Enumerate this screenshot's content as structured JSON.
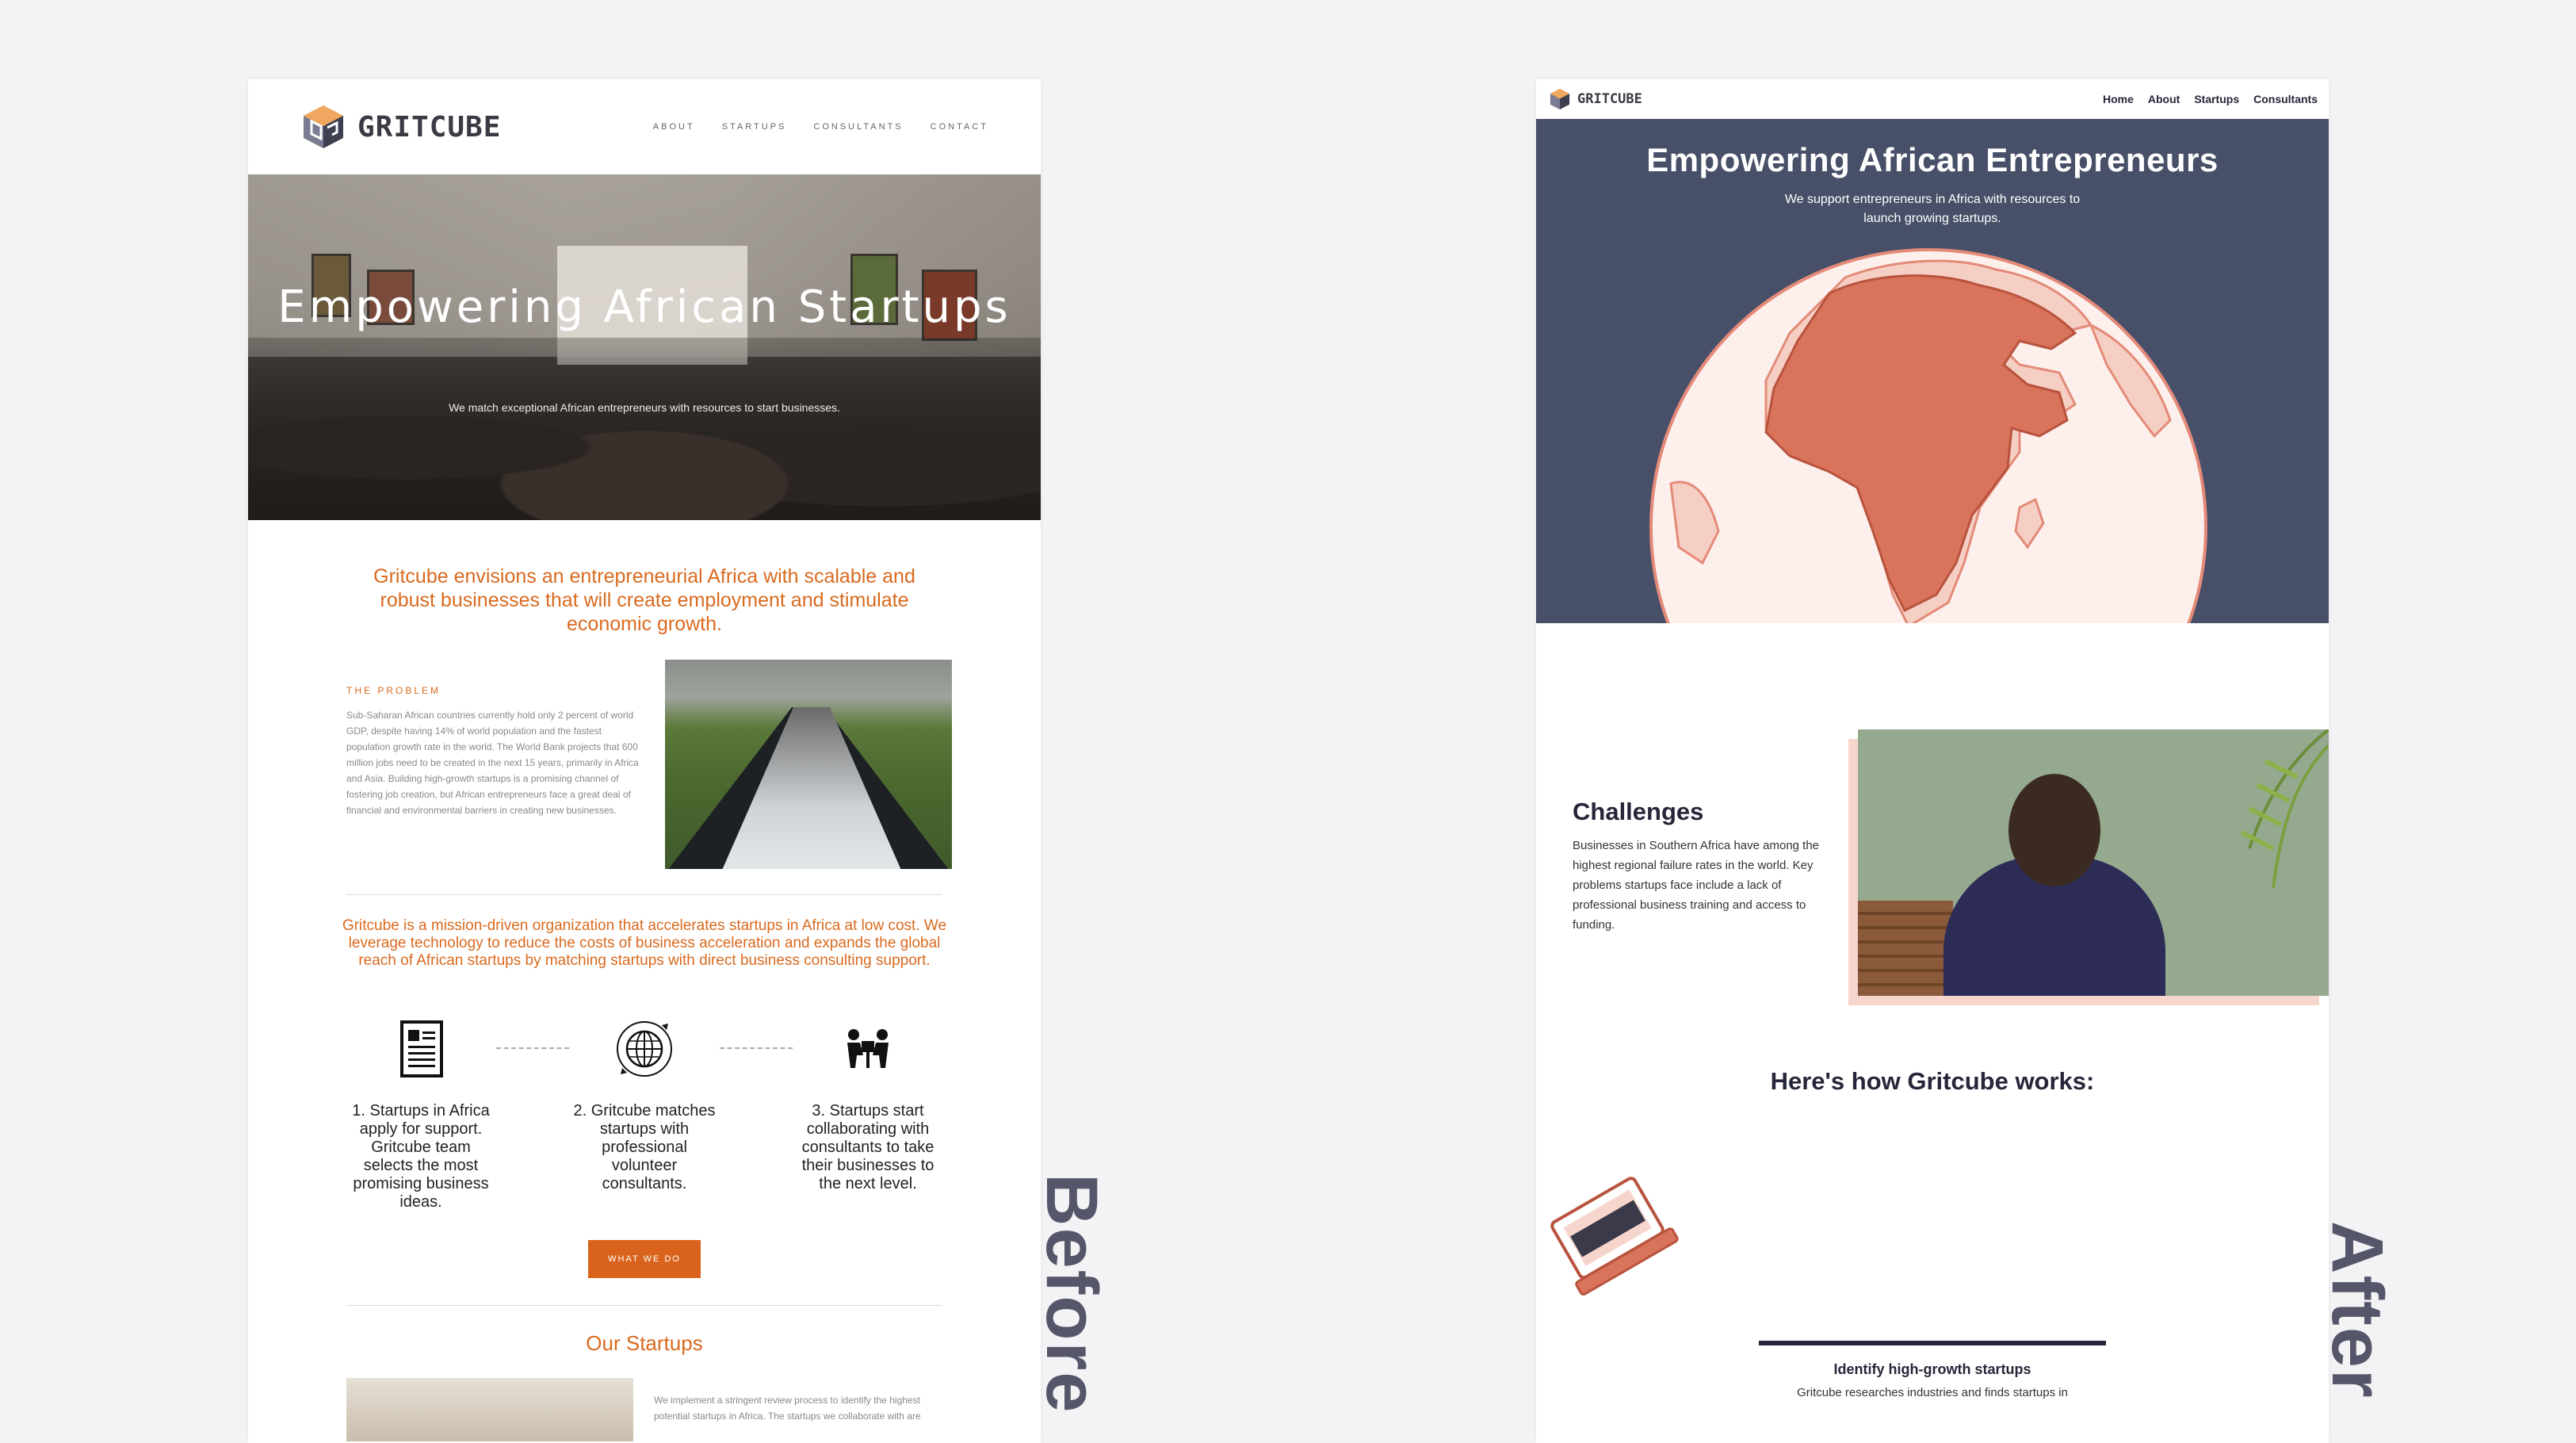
{
  "before": {
    "label": "Before",
    "logo_text": "GRITCUBE",
    "nav": [
      "ABOUT",
      "STARTUPS",
      "CONSULTANTS",
      "CONTACT"
    ],
    "hero_title": "Empowering African Startups",
    "hero_subtitle": "We match exceptional African entrepreneurs with resources to start businesses.",
    "vision": "Gritcube envisions an entrepreneurial Africa with scalable and robust businesses that will create employment and stimulate economic growth.",
    "problem_label": "THE PROBLEM",
    "problem_body": "Sub-Saharan African countries currently hold only 2 percent of world GDP, despite having 14% of world population and the fastest population growth rate in the world. The World Bank projects that 600 million jobs need to be created in the next 15 years, primarily in Africa and Asia. Building high-growth startups is a promising channel of fostering job creation, but African entrepreneurs face a great deal of financial and environmental barriers in creating new businesses.",
    "mission": "Gritcube is a mission-driven organization that accelerates startups in Africa at low cost. We leverage technology to reduce the costs of business acceleration and expands the global reach of African startups by matching startups with direct business consulting support.",
    "steps": [
      {
        "icon": "document-icon",
        "text": "1. Startups in Africa apply for support. Gritcube team selects the most promising business ideas."
      },
      {
        "icon": "globe-icon",
        "text": "2. Gritcube matches startups with professional volunteer consultants."
      },
      {
        "icon": "collaboration-icon",
        "text": "3. Startups start collaborating with consultants to take their businesses to the next level."
      }
    ],
    "cta": "WHAT WE DO",
    "startups_title": "Our Startups",
    "startups_body": "We implement a stringent review process to identify the highest potential startups in Africa. The startups we collaborate with are"
  },
  "after": {
    "label": "After",
    "logo_text": "GRITCUBE",
    "nav": [
      "Home",
      "About",
      "Startups",
      "Consultants"
    ],
    "hero_title": "Empowering African Entrepreneurs",
    "hero_subtitle": "We support entrepreneurs in Africa with resources to launch growing startups.",
    "challenges_title": "Challenges",
    "challenges_body": "Businesses in Southern Africa have among the highest regional failure rates in the world. Key problems startups face include a lack of professional business training and access to funding.",
    "how_title": "Here's how Gritcube works:",
    "step_title": "Identify high-growth startups",
    "step_body": "Gritcube researches industries and finds startups in"
  },
  "colors": {
    "orange": "#d96a1f",
    "navy": "#475068",
    "dark": "#26263a",
    "coral": "#d9735c",
    "pink": "#f6d6cc"
  }
}
